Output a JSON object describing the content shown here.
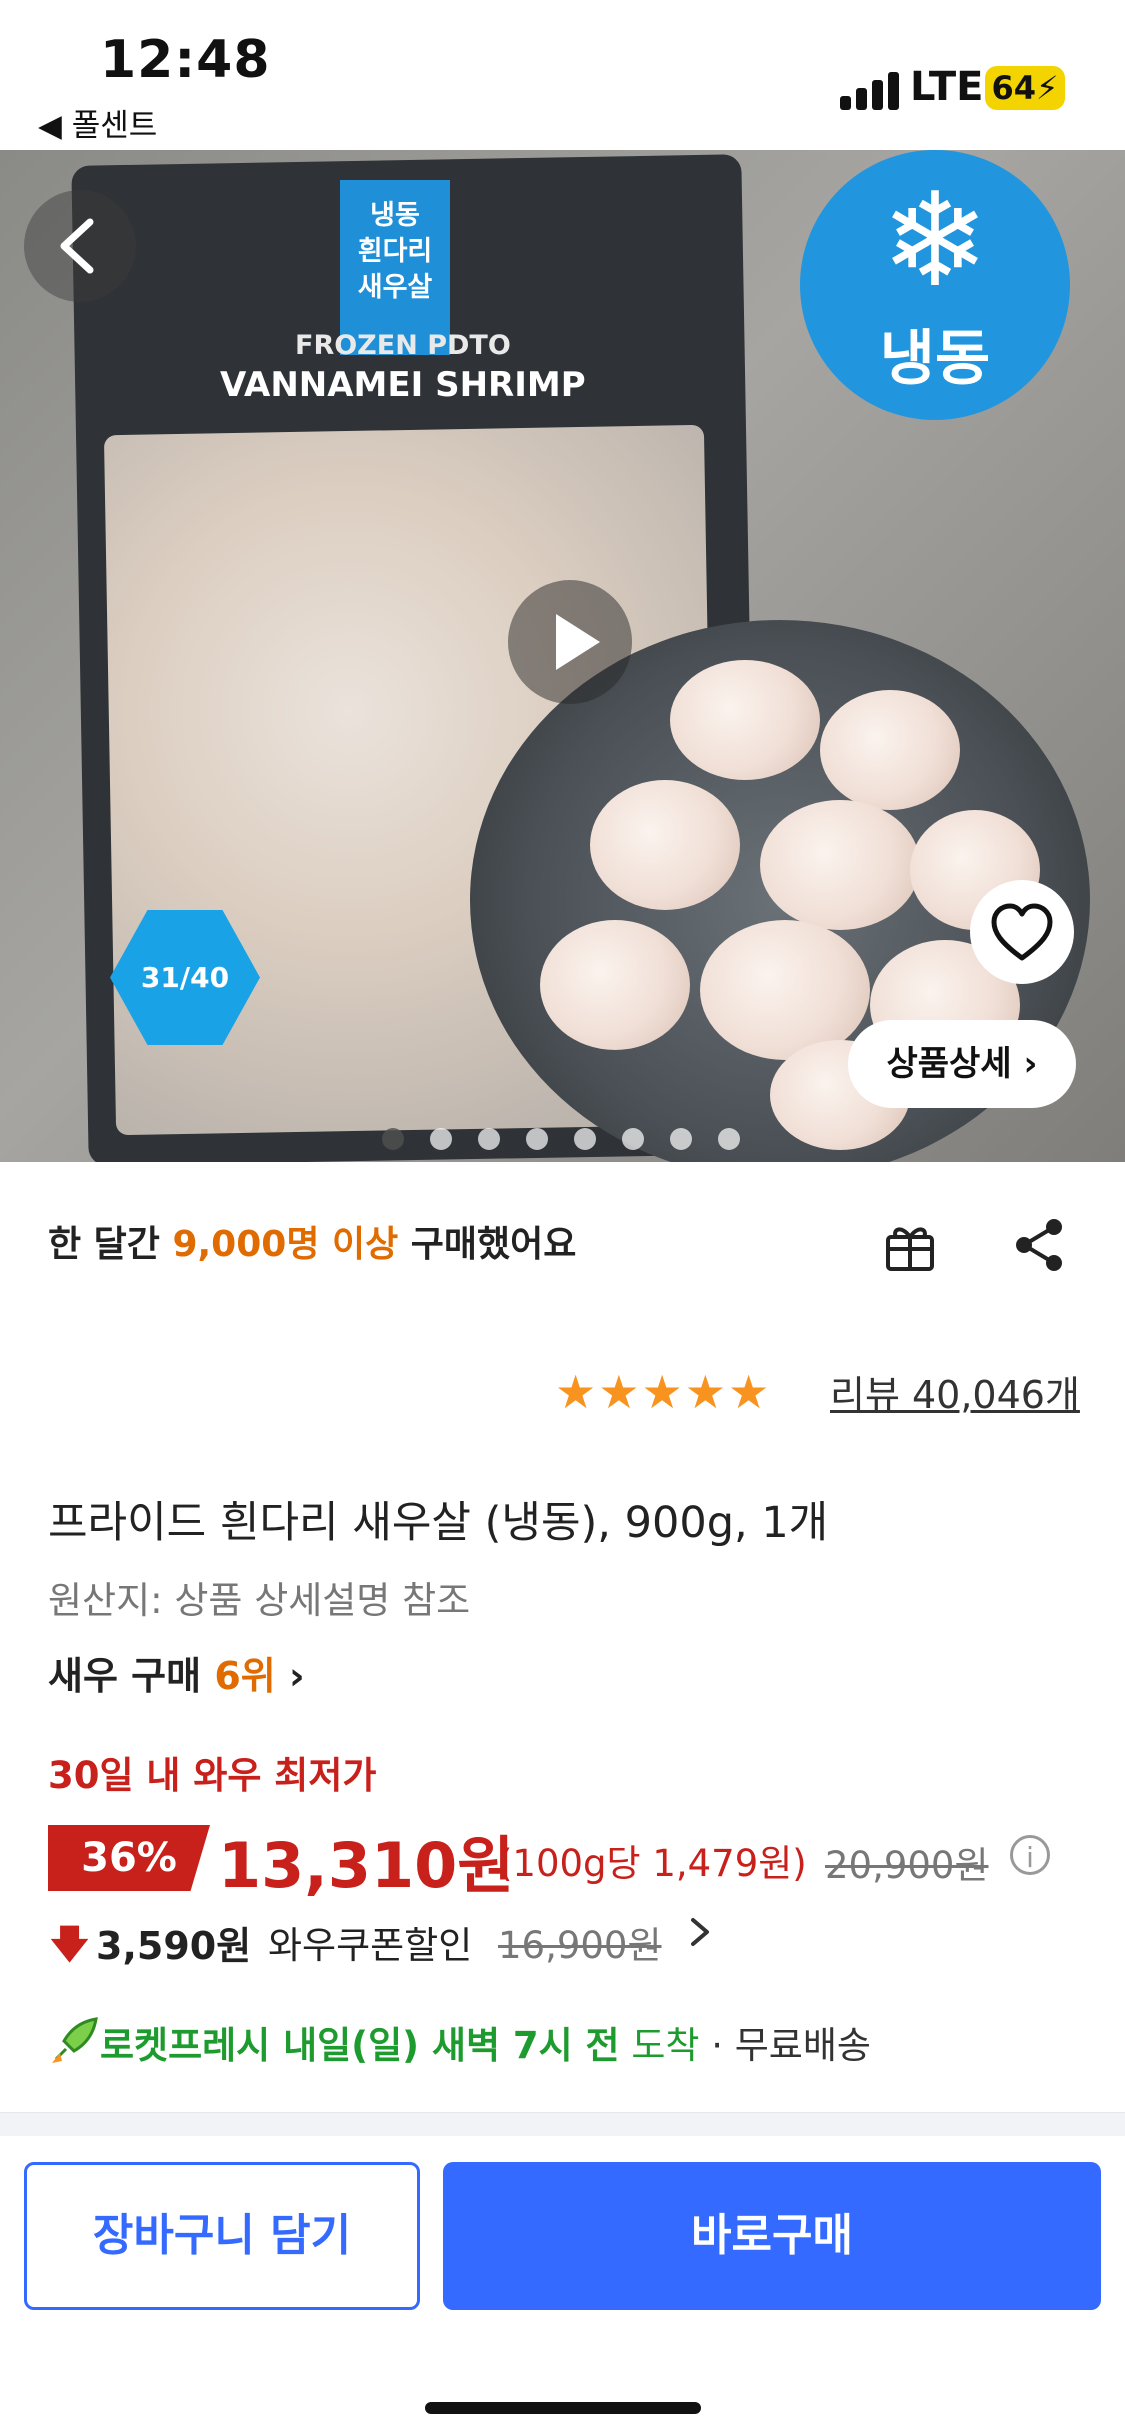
{
  "status_bar": {
    "time": "12:48",
    "back_app": "◀ 폴센트",
    "network": "LTE",
    "battery": "64"
  },
  "hero": {
    "package": {
      "tag_text": "냉동\n흰다리\n새우살",
      "title_small": "FROZEN PDTO",
      "title_large": "VANNAMEI SHRIMP",
      "badge_text": "31/40"
    },
    "frozen_badge_label": "냉동",
    "detail_button": "상품상세",
    "carousel_index": 1,
    "carousel_count": 8
  },
  "social": {
    "purchase_prefix": "한 달간",
    "purchase_highlight": "9,000명 이상",
    "purchase_suffix": "구매했어요"
  },
  "rating": {
    "stars": 5,
    "review_text": "리뷰 40,046개"
  },
  "product": {
    "title": "프라이드 흰다리 새우살 (냉동), 900g, 1개",
    "origin": "원산지: 상품 상세설명 참조",
    "rank_label": "새우 구매",
    "rank_value": "6위"
  },
  "pricing": {
    "lowest_label": "30일 내 와우 최저가",
    "discount": "36%",
    "price": "13,310원",
    "unit_price": "(100g당 1,479원)",
    "original_price": "20,900원",
    "coupon_amount": "3,590원",
    "coupon_label": "와우쿠폰할인",
    "coupon_original": "16,900원"
  },
  "delivery": {
    "rocket": "로켓프레시 내일(일) 새벽 7시 전",
    "arrive": "도착",
    "sep": " · ",
    "shipping": "무료배송"
  },
  "actions": {
    "cart": "장바구니 담기",
    "buy": "바로구매"
  },
  "colors": {
    "accent_blue": "#346aff",
    "price_red": "#c8201b",
    "highlight_orange": "#e06b00",
    "rocket_green": "#1e9b2e",
    "star_orange": "#f7931e",
    "frozen_blue": "#2196de"
  }
}
